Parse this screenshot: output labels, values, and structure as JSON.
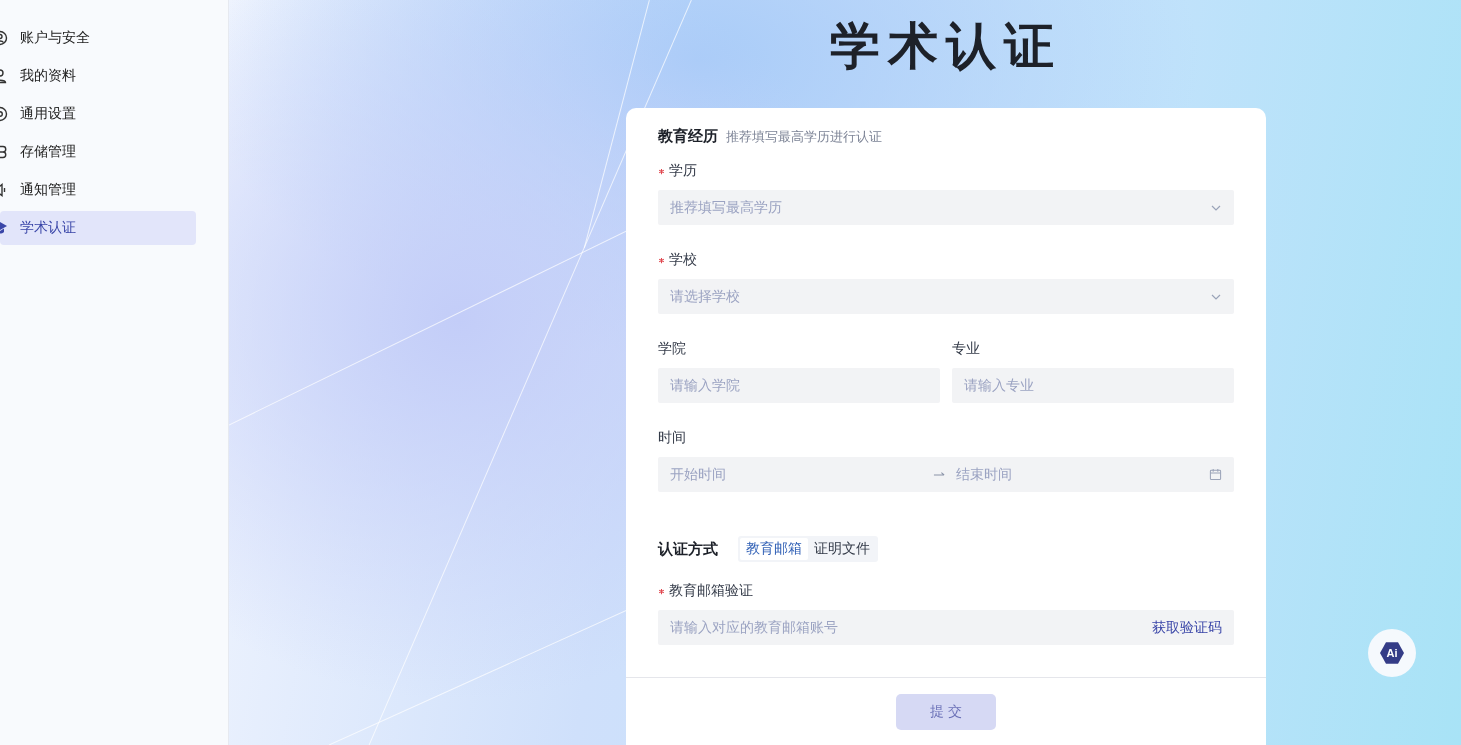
{
  "sidebar": {
    "items": [
      {
        "label": "账户与安全",
        "selected": false
      },
      {
        "label": "我的资料",
        "selected": false
      },
      {
        "label": "通用设置",
        "selected": false
      },
      {
        "label": "存储管理",
        "selected": false
      },
      {
        "label": "通知管理",
        "selected": false
      },
      {
        "label": "学术认证",
        "selected": true
      }
    ]
  },
  "title": "学术认证",
  "education": {
    "title": "教育经历",
    "hint": "推荐填写最高学历进行认证",
    "fields": [
      {
        "kind": "select",
        "label": "学历",
        "required": true,
        "placeholder": "推荐填写最高学历"
      },
      {
        "kind": "select",
        "label": "学校",
        "required": true,
        "placeholder": "请选择学校"
      },
      {
        "kind": "pair",
        "items": [
          {
            "label": "学院",
            "required": false,
            "placeholder": "请输入学院"
          },
          {
            "label": "专业",
            "required": false,
            "placeholder": "请输入专业"
          }
        ]
      },
      {
        "kind": "date-range",
        "label": "时间",
        "required": false,
        "start_placeholder": "开始时间",
        "end_placeholder": "结束时间"
      }
    ]
  },
  "verification": {
    "title": "认证方式",
    "tabs": [
      {
        "label": "教育邮箱",
        "selected": true
      },
      {
        "label": "证明文件",
        "selected": false
      }
    ],
    "field": {
      "label": "教育邮箱验证",
      "required": true,
      "placeholder": "请输入对应的教育邮箱账号",
      "action": "获取验证码"
    }
  },
  "submit": {
    "label": "提 交",
    "disabled": true
  },
  "ai_button": {
    "label": "Ai"
  }
}
